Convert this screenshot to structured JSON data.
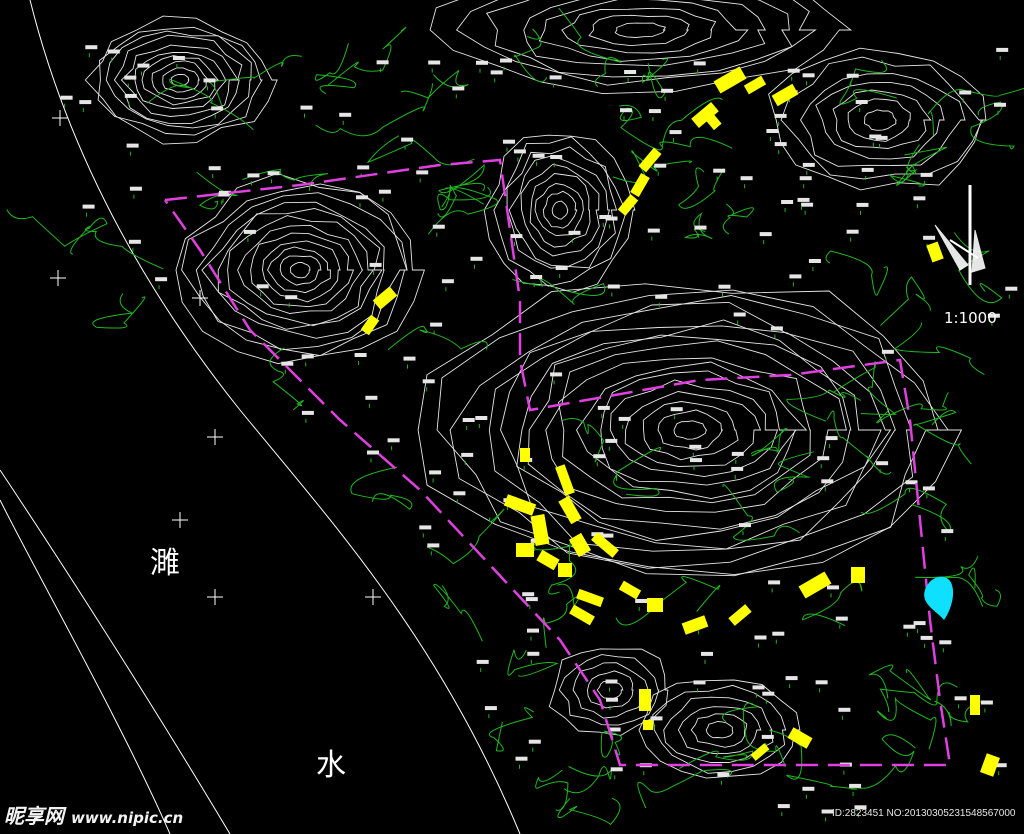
{
  "map": {
    "river_label": [
      "濉",
      "水"
    ],
    "scale_label": "1:1000",
    "colors": {
      "background": "#000000",
      "contour": "#ffffff",
      "vegetation_boundary": "#1fb81f",
      "site_boundary": "#e040e0",
      "building": "#ffff00",
      "pond": "#10e0ff"
    },
    "icons": [
      "north-arrow-icon",
      "survey-cross-icon"
    ]
  },
  "watermark": {
    "brand": "昵享网",
    "site": "www.nipic.cn",
    "image_id": "ID:2823451 NO:20130305231548567000"
  }
}
